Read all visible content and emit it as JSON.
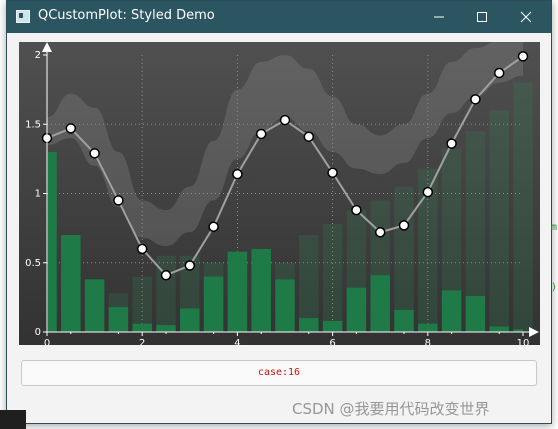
{
  "window": {
    "title": "QCustomPlot: Styled Demo",
    "title_bar_color": "#2c5562"
  },
  "status": {
    "text": "case:16"
  },
  "watermark": {
    "text": "CSDN @我要用代码改变世界"
  },
  "background_fragments": {
    "frag1": "m",
    "frag2": ")"
  },
  "icons": {
    "app": "app-window-icon",
    "minimize": "minimize-icon",
    "maximize": "maximize-icon",
    "close": "close-icon"
  },
  "chart_data": {
    "type": "line",
    "xlim": [
      0,
      10
    ],
    "ylim": [
      0,
      2
    ],
    "x_ticks": [
      "0",
      "2",
      "4",
      "6",
      "8",
      "10"
    ],
    "y_ticks": [
      "0",
      "0.5",
      "1",
      "1.5",
      "2"
    ],
    "grid": true,
    "colors": {
      "background_top": "#505050",
      "background_bottom": "#323232",
      "line": "#a0a0a0",
      "marker_fill": "#ffffff",
      "bars": "#1e7a46",
      "bars_faint": "#2e8a55",
      "axis": "#ffffff",
      "band": "#8a8a8a"
    },
    "series": [
      {
        "type": "line",
        "x": [
          0,
          0.5,
          1.0,
          1.5,
          2.0,
          2.5,
          3.0,
          3.5,
          4.0,
          4.5,
          5.0,
          5.5,
          6.0,
          6.5,
          7.0,
          7.5,
          8.0,
          8.5,
          9.0,
          9.5,
          10.0
        ],
        "values": [
          1.4,
          1.47,
          1.29,
          0.95,
          0.6,
          0.41,
          0.48,
          0.76,
          1.14,
          1.43,
          1.53,
          1.41,
          1.15,
          0.88,
          0.72,
          0.77,
          1.01,
          1.36,
          1.68,
          1.87,
          1.99
        ]
      },
      {
        "type": "bar",
        "x": [
          0,
          0.5,
          1.0,
          1.5,
          2.0,
          2.5,
          3.0,
          3.5,
          4.0,
          4.5,
          5.0,
          5.5,
          6.0,
          6.5,
          7.0,
          7.5,
          8.0,
          8.5,
          9.0,
          9.5,
          10.0
        ],
        "values": [
          1.3,
          0.7,
          0.38,
          0.18,
          0.06,
          0.05,
          0.17,
          0.4,
          0.58,
          0.6,
          0.38,
          0.1,
          0.08,
          0.32,
          0.41,
          0.16,
          0.06,
          0.3,
          0.26,
          0.04,
          0.02
        ]
      },
      {
        "type": "bar_faint",
        "x": [
          0,
          0.5,
          1.0,
          1.5,
          2.0,
          2.5,
          3.0,
          3.5,
          4.0,
          4.5,
          5.0,
          5.5,
          6.0,
          6.5,
          7.0,
          7.5,
          8.0,
          8.5,
          9.0,
          9.5,
          10.0
        ],
        "values": [
          0.0,
          0.05,
          0.1,
          0.28,
          0.4,
          0.55,
          0.55,
          0.5,
          0.4,
          0.45,
          0.5,
          0.7,
          0.78,
          0.88,
          0.95,
          1.05,
          1.18,
          1.32,
          1.45,
          1.6,
          1.8
        ]
      },
      {
        "type": "band",
        "x": [
          0,
          0.5,
          1.0,
          1.5,
          2.0,
          2.5,
          3.0,
          3.5,
          4.0,
          4.5,
          5.0,
          5.5,
          6.0,
          6.5,
          7.0,
          7.5,
          8.0,
          8.5,
          9.0,
          9.5,
          10.0
        ],
        "upper": [
          1.55,
          1.72,
          1.62,
          1.3,
          0.95,
          0.88,
          1.05,
          1.38,
          1.75,
          1.95,
          2.0,
          1.9,
          1.7,
          1.5,
          1.42,
          1.5,
          1.72,
          1.95,
          2.05,
          2.1,
          2.1
        ],
        "lower": [
          1.35,
          1.4,
          1.2,
          0.9,
          0.68,
          0.62,
          0.72,
          0.95,
          1.25,
          1.45,
          1.55,
          1.45,
          1.3,
          1.18,
          1.14,
          1.22,
          1.4,
          1.58,
          1.7,
          1.8,
          1.85
        ]
      }
    ]
  }
}
